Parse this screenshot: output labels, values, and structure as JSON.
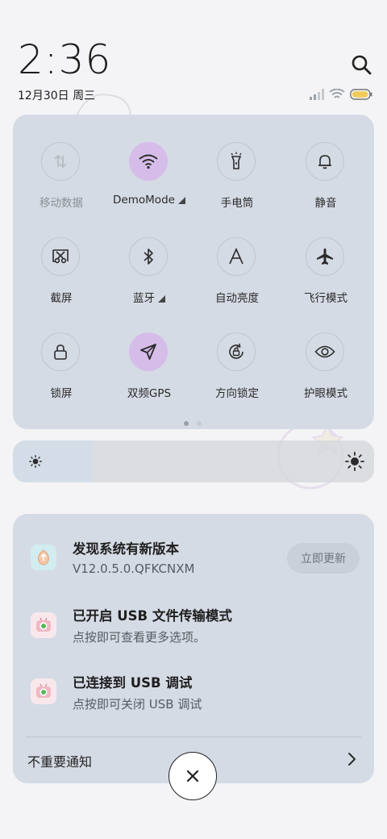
{
  "status": {
    "time": "2:36",
    "date": "12月30日 周三"
  },
  "quick_settings": {
    "tiles": [
      {
        "label": "移动数据",
        "icon": "mobile-data-icon",
        "active": false,
        "dim": true,
        "has_menu": false
      },
      {
        "label": "DemoMode",
        "icon": "wifi-icon",
        "active": true,
        "dim": false,
        "has_menu": true
      },
      {
        "label": "手电筒",
        "icon": "flashlight-icon",
        "active": false,
        "dim": false,
        "has_menu": false
      },
      {
        "label": "静音",
        "icon": "bell-icon",
        "active": false,
        "dim": false,
        "has_menu": false
      },
      {
        "label": "截屏",
        "icon": "screenshot-icon",
        "active": false,
        "dim": false,
        "has_menu": false
      },
      {
        "label": "蓝牙",
        "icon": "bluetooth-icon",
        "active": false,
        "dim": false,
        "has_menu": true
      },
      {
        "label": "自动亮度",
        "icon": "auto-brightness-icon",
        "active": false,
        "dim": false,
        "has_menu": false
      },
      {
        "label": "飞行模式",
        "icon": "airplane-icon",
        "active": false,
        "dim": false,
        "has_menu": false
      },
      {
        "label": "锁屏",
        "icon": "lock-icon",
        "active": false,
        "dim": false,
        "has_menu": false
      },
      {
        "label": "双频GPS",
        "icon": "gps-icon",
        "active": true,
        "dim": false,
        "has_menu": false
      },
      {
        "label": "方向锁定",
        "icon": "rotation-lock-icon",
        "active": false,
        "dim": false,
        "has_menu": false
      },
      {
        "label": "护眼模式",
        "icon": "eye-icon",
        "active": false,
        "dim": false,
        "has_menu": false
      }
    ],
    "page_count": 2,
    "current_page": 1
  },
  "brightness": {
    "level_fraction": 0.22
  },
  "notifications": [
    {
      "title": "发现系统有新版本",
      "subtitle": "V12.0.5.0.QFKCNXM",
      "icon": "update-app-icon",
      "action_label": "立即更新"
    },
    {
      "title": "已开启 USB 文件传输模式",
      "subtitle": "点按即可查看更多选项。",
      "icon": "android-system-icon"
    },
    {
      "title": "已连接到 USB 调试",
      "subtitle": "点按即可关闭 USB 调试",
      "icon": "android-system-icon"
    }
  ],
  "minor_notifications_label": "不重要通知",
  "colors": {
    "panel": "#d5dbe5",
    "active_tile": "#d6bde9"
  }
}
